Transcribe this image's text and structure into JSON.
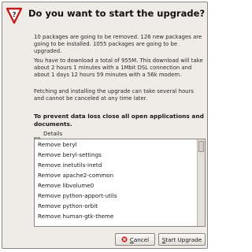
{
  "dialog": {
    "title": "Do you want to start the upgrade?",
    "paragraph1": "10 packages are going to be removed. 126 new packages are going to be installed. 1055 packages are going to be upgraded.",
    "paragraph2": "You have to download a total of 955M. This download will take about 2 hours 1 minutes with a 1Mbit DSL connection and about 1 days 12 hours 59 minutes with a 56k modem.",
    "paragraph3": "Fetching and installing the upgrade can take several hours and cannot be canceled at any time later.",
    "warning": "To prevent data loss close all open applications and documents.",
    "details_label": "Details",
    "details_items": [
      "Remove beryl",
      "Remove beryl-settings",
      "Remove inetutils-inetd",
      "Remove apache2-common",
      "Remove libvolume0",
      "Remove python-apport-utils",
      "Remove python-orbit",
      "Remove human-gtk-theme"
    ],
    "buttons": {
      "cancel_first": "C",
      "cancel_rest": "ancel",
      "start_first": "S",
      "start_rest": "tart Upgrade"
    }
  },
  "icons": {
    "question": "question-icon",
    "details_arrow": "expander-down-icon",
    "cancel": "cancel-icon"
  },
  "colors": {
    "dialog_bg": "#efebe7",
    "icon_red": "#c41c1c",
    "cancel_icon": "#cc2222"
  }
}
